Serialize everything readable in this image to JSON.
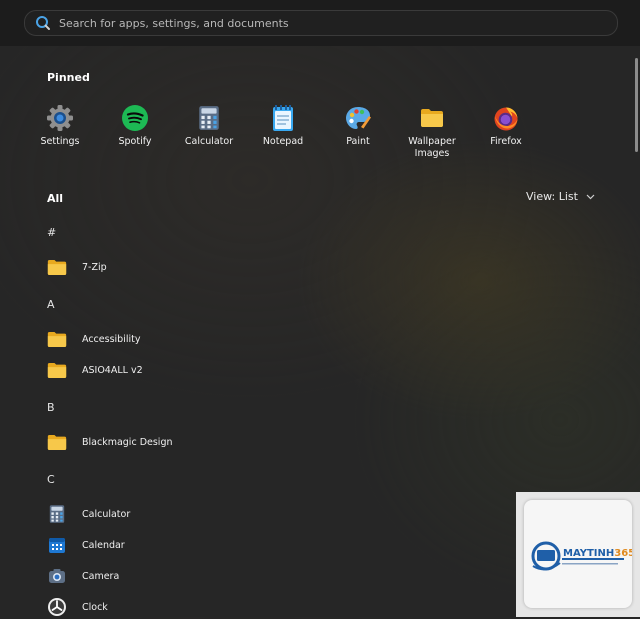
{
  "search": {
    "placeholder": "Search for apps, settings, and documents",
    "icon": "search-icon"
  },
  "pinned": {
    "title": "Pinned",
    "apps": [
      {
        "label": "Settings",
        "icon": "gear-icon"
      },
      {
        "label": "Spotify",
        "icon": "spotify-icon"
      },
      {
        "label": "Calculator",
        "icon": "calculator-icon"
      },
      {
        "label": "Notepad",
        "icon": "notepad-icon"
      },
      {
        "label": "Paint",
        "icon": "paint-palette-icon"
      },
      {
        "label": "Wallpaper Images",
        "icon": "folder-icon"
      },
      {
        "label": "Firefox",
        "icon": "firefox-icon"
      }
    ]
  },
  "all": {
    "title": "All",
    "view_label": "View: List",
    "groups": [
      {
        "letter": "#",
        "items": [
          {
            "label": "7-Zip",
            "icon": "folder-icon"
          }
        ]
      },
      {
        "letter": "A",
        "items": [
          {
            "label": "Accessibility",
            "icon": "folder-icon"
          },
          {
            "label": "ASIO4ALL v2",
            "icon": "folder-icon"
          }
        ]
      },
      {
        "letter": "B",
        "items": [
          {
            "label": "Blackmagic Design",
            "icon": "folder-icon"
          }
        ]
      },
      {
        "letter": "C",
        "items": [
          {
            "label": "Calculator",
            "icon": "calculator-icon"
          },
          {
            "label": "Calendar",
            "icon": "calendar-icon"
          },
          {
            "label": "Camera",
            "icon": "camera-icon"
          },
          {
            "label": "Clock",
            "icon": "clock-icon"
          }
        ]
      }
    ]
  },
  "watermark": {
    "brand": "MAYTINH365"
  },
  "colors": {
    "background": "#262626",
    "search_bg": "#202020",
    "folder": "#f5c542",
    "accent": "#4aa3e6"
  }
}
